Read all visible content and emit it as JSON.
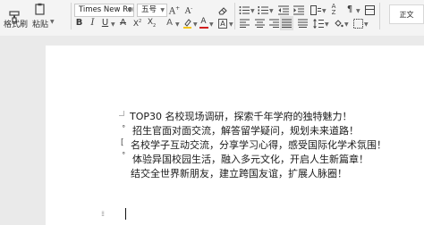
{
  "toolbar": {
    "format_painter_label": "格式刷",
    "paste_label": "粘贴",
    "font_name": "Times New Rom",
    "font_size": "五号",
    "style_name": "正文"
  },
  "document": {
    "lines": [
      "TOP30 名校现场调研，探索千年学府的独特魅力！",
      "招生官面对面交流，解答留学疑问，规划未来道路！",
      "名校学子互动交流，分享学习心得，感受国际化学术氛围！",
      "体验异国校园生活，融入多元文化，开启人生新篇章！",
      "结交全世界新朋友，建立跨国友谊，扩展人脉圈！"
    ]
  },
  "colors": {
    "highlight": "#f5c518",
    "font_color": "#d11d1d",
    "text": "#1a1a1a",
    "ribbon_bg": "#f4f4f4",
    "canvas_bg": "#eaeaea"
  }
}
